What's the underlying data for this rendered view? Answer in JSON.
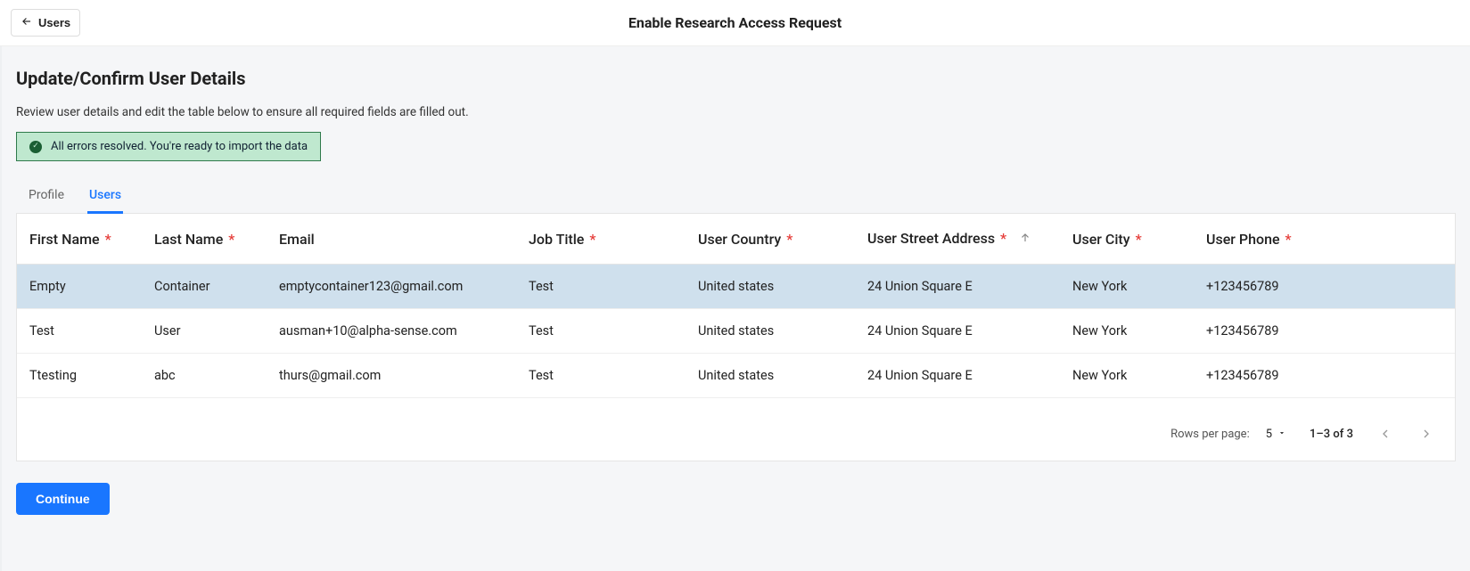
{
  "header": {
    "back_label": "Users",
    "title": "Enable Research Access Request"
  },
  "page": {
    "heading": "Update/Confirm User Details",
    "subtext": "Review user details and edit the table below to ensure all required fields are filled out.",
    "alert": "All errors resolved. You're ready to import the data"
  },
  "tabs": {
    "profile": "Profile",
    "users": "Users"
  },
  "table": {
    "columns": {
      "first_name": "First Name",
      "last_name": "Last Name",
      "email": "Email",
      "job_title": "Job Title",
      "user_country": "User Country",
      "user_street_address": "User Street Address",
      "user_city": "User City",
      "user_phone": "User Phone"
    },
    "rows": [
      {
        "first_name": "Empty",
        "last_name": "Container",
        "email": "emptycontainer123@gmail.com",
        "job_title": "Test",
        "user_country": "United states",
        "user_street_address": "24 Union Square E",
        "user_city": "New York",
        "user_phone": "+123456789"
      },
      {
        "first_name": "Test",
        "last_name": "User",
        "email": "ausman+10@alpha-sense.com",
        "job_title": "Test",
        "user_country": "United states",
        "user_street_address": "24 Union Square E",
        "user_city": "New York",
        "user_phone": "+123456789"
      },
      {
        "first_name": "Ttesting",
        "last_name": "abc",
        "email": "thurs@gmail.com",
        "job_title": "Test",
        "user_country": "United states",
        "user_street_address": "24 Union Square E",
        "user_city": "New York",
        "user_phone": "+123456789"
      }
    ]
  },
  "pagination": {
    "rows_per_page_label": "Rows per page:",
    "rows_per_page_value": "5",
    "range_text": "1–3 of 3"
  },
  "actions": {
    "continue": "Continue"
  },
  "required_marker": "*"
}
